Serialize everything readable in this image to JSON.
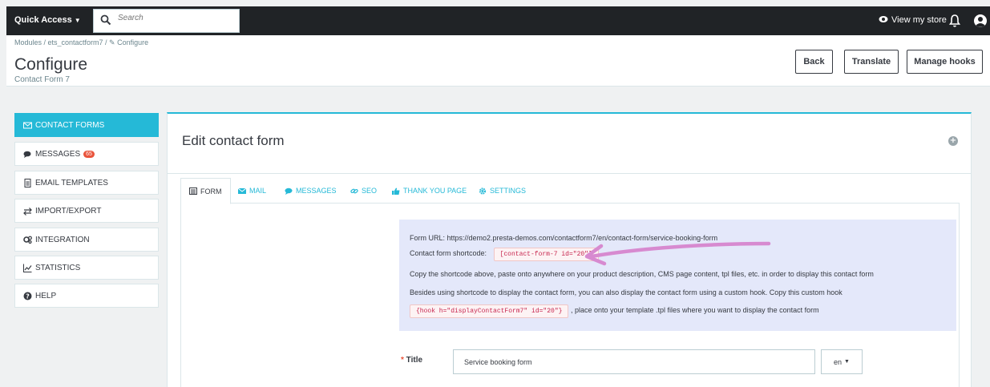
{
  "topbar": {
    "quick_access": "Quick Access",
    "search_placeholder": "Search",
    "view_store": "View my store"
  },
  "header": {
    "breadcrumb": "Modules  /  ets_contactform7  /  ✎ Configure",
    "title": "Configure",
    "subtitle": "Contact Form 7",
    "buttons": {
      "back": "Back",
      "translate": "Translate",
      "manage_hooks": "Manage hooks"
    }
  },
  "sidebar": {
    "items": [
      {
        "label": "CONTACT FORMS",
        "icon": "envelope-icon"
      },
      {
        "label": "MESSAGES",
        "icon": "comments-icon",
        "badge": "65"
      },
      {
        "label": "EMAIL TEMPLATES",
        "icon": "file-icon"
      },
      {
        "label": "IMPORT/EXPORT",
        "icon": "exchange-icon"
      },
      {
        "label": "INTEGRATION",
        "icon": "cogs-icon"
      },
      {
        "label": "STATISTICS",
        "icon": "line-chart-icon"
      },
      {
        "label": "HELP",
        "icon": "question-circle-icon"
      }
    ]
  },
  "panel": {
    "title": "Edit contact form",
    "tabs": [
      {
        "label": "FORM",
        "icon": "list-alt-icon"
      },
      {
        "label": "MAIL",
        "icon": "envelope-icon"
      },
      {
        "label": "MESSAGES",
        "icon": "comments-icon"
      },
      {
        "label": "SEO",
        "icon": "link-icon"
      },
      {
        "label": "THANK YOU PAGE",
        "icon": "thumbs-up-icon"
      },
      {
        "label": "SETTINGS",
        "icon": "cog-icon"
      }
    ],
    "info": {
      "form_url": "Form URL: https://demo2.presta-demos.com/contactform7/en/contact-form/service-booking-form",
      "shortcode_label": "Contact form shortcode:",
      "shortcode": "[contact-form-7 id=\"20\"]",
      "copy_note": "Copy the shortcode above, paste onto anywhere on your product description, CMS page content, tpl files, etc. in order to display this contact form",
      "hook_note": "Besides using shortcode to display the contact form, you can also display the contact form using a custom hook. Copy this custom hook",
      "hook_code": "{hook h=\"displayContactForm7\" id=\"20\"}",
      "hook_suffix": ", place onto your template .tpl files where you want to display the contact form"
    },
    "form": {
      "title_label": "Title",
      "title_value": "Service booking form",
      "lang": "en"
    }
  },
  "colors": {
    "accent": "#25b9d7",
    "topbar": "#202326",
    "annotation_arrow": "#d78ad0",
    "badge": "#e9543c"
  }
}
